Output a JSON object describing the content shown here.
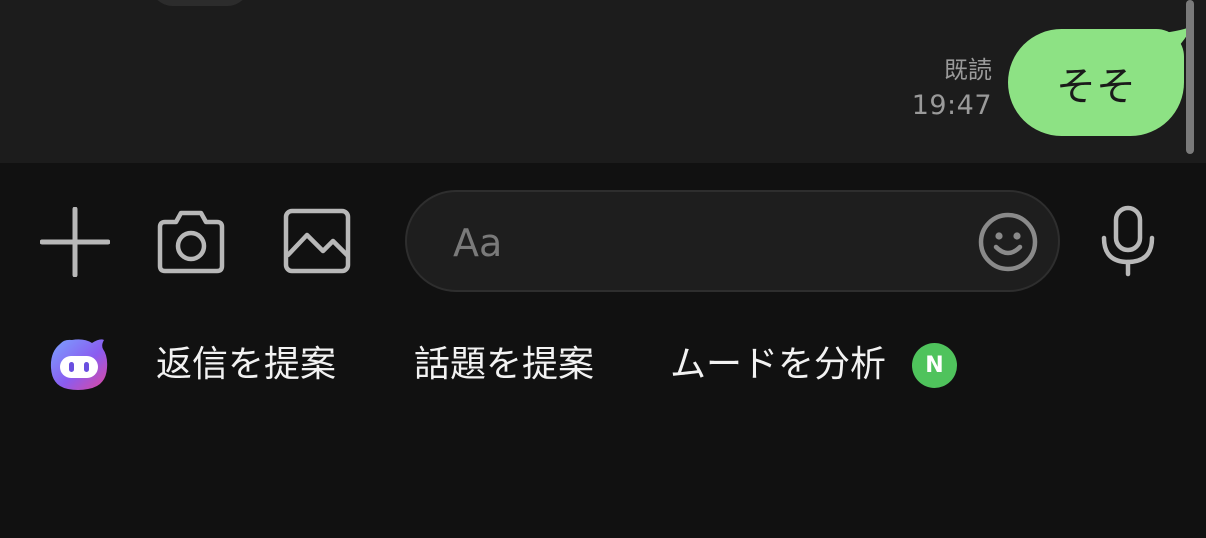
{
  "chat": {
    "messages": [
      {
        "text": "そそ",
        "read_label": "既読",
        "time": "19:47",
        "direction": "outgoing"
      }
    ]
  },
  "input_bar": {
    "placeholder": "Aa",
    "value": "",
    "icons": {
      "plus": "plus-icon",
      "camera": "camera-icon",
      "image": "image-icon",
      "emoji": "emoji-icon",
      "mic": "microphone-icon"
    }
  },
  "suggestions": {
    "items": [
      {
        "label": "返信を提案"
      },
      {
        "label": "話題を提案"
      },
      {
        "label": "ムードを分析",
        "badge": "N"
      }
    ]
  },
  "colors": {
    "background": "#111111",
    "chat_background": "#1c1c1c",
    "outgoing_bubble": "#8de284",
    "badge": "#4fc35c",
    "icon_gray": "#b8b8b8",
    "meta_text": "#9a9a9a"
  }
}
